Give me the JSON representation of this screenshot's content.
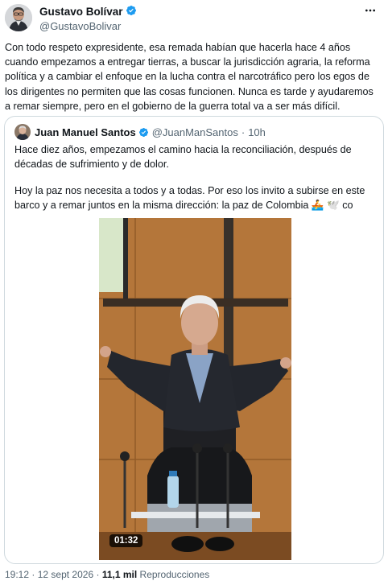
{
  "tweet": {
    "author": {
      "name": "Gustavo Bolívar",
      "handle": "@GustavoBolivar",
      "verified": true
    },
    "text": "Con todo respeto expresidente, esa remada habían que hacerla hace 4 años cuando empezamos a entregar tierras, a buscar la jurisdicción agraria, la reforma política y a cambiar el enfoque en la lucha contra el narcotráfico pero los egos de los dirigentes no permiten que las cosas funcionen. Nunca es tarde y ayudaremos a remar siempre, pero en el gobierno de la guerra total va a ser más difícil.",
    "more_icon": "more-horizontal-icon",
    "time": "19:12",
    "date": "12 sept 2026",
    "views_count": "11,1 mil",
    "views_label": "Reproducciones"
  },
  "quoted": {
    "author": {
      "name": "Juan Manuel Santos",
      "handle": "@JuanManSantos",
      "verified": true
    },
    "time_ago": "10h",
    "paragraph1": "Hace diez años, empezamos el camino hacia la reconciliación, después de décadas de sufrimiento y de dolor.",
    "paragraph2": "Hoy la paz nos necesita a todos y a todas. Por eso los invito a subirse en este barco y a remar juntos en la misma dirección: la paz de Colombia 🚣 🕊️ co",
    "video": {
      "duration": "01:32"
    }
  },
  "colors": {
    "text": "#0f1419",
    "secondary": "#536471",
    "verified": "#1d9bf0",
    "border": "#cfd9de"
  }
}
